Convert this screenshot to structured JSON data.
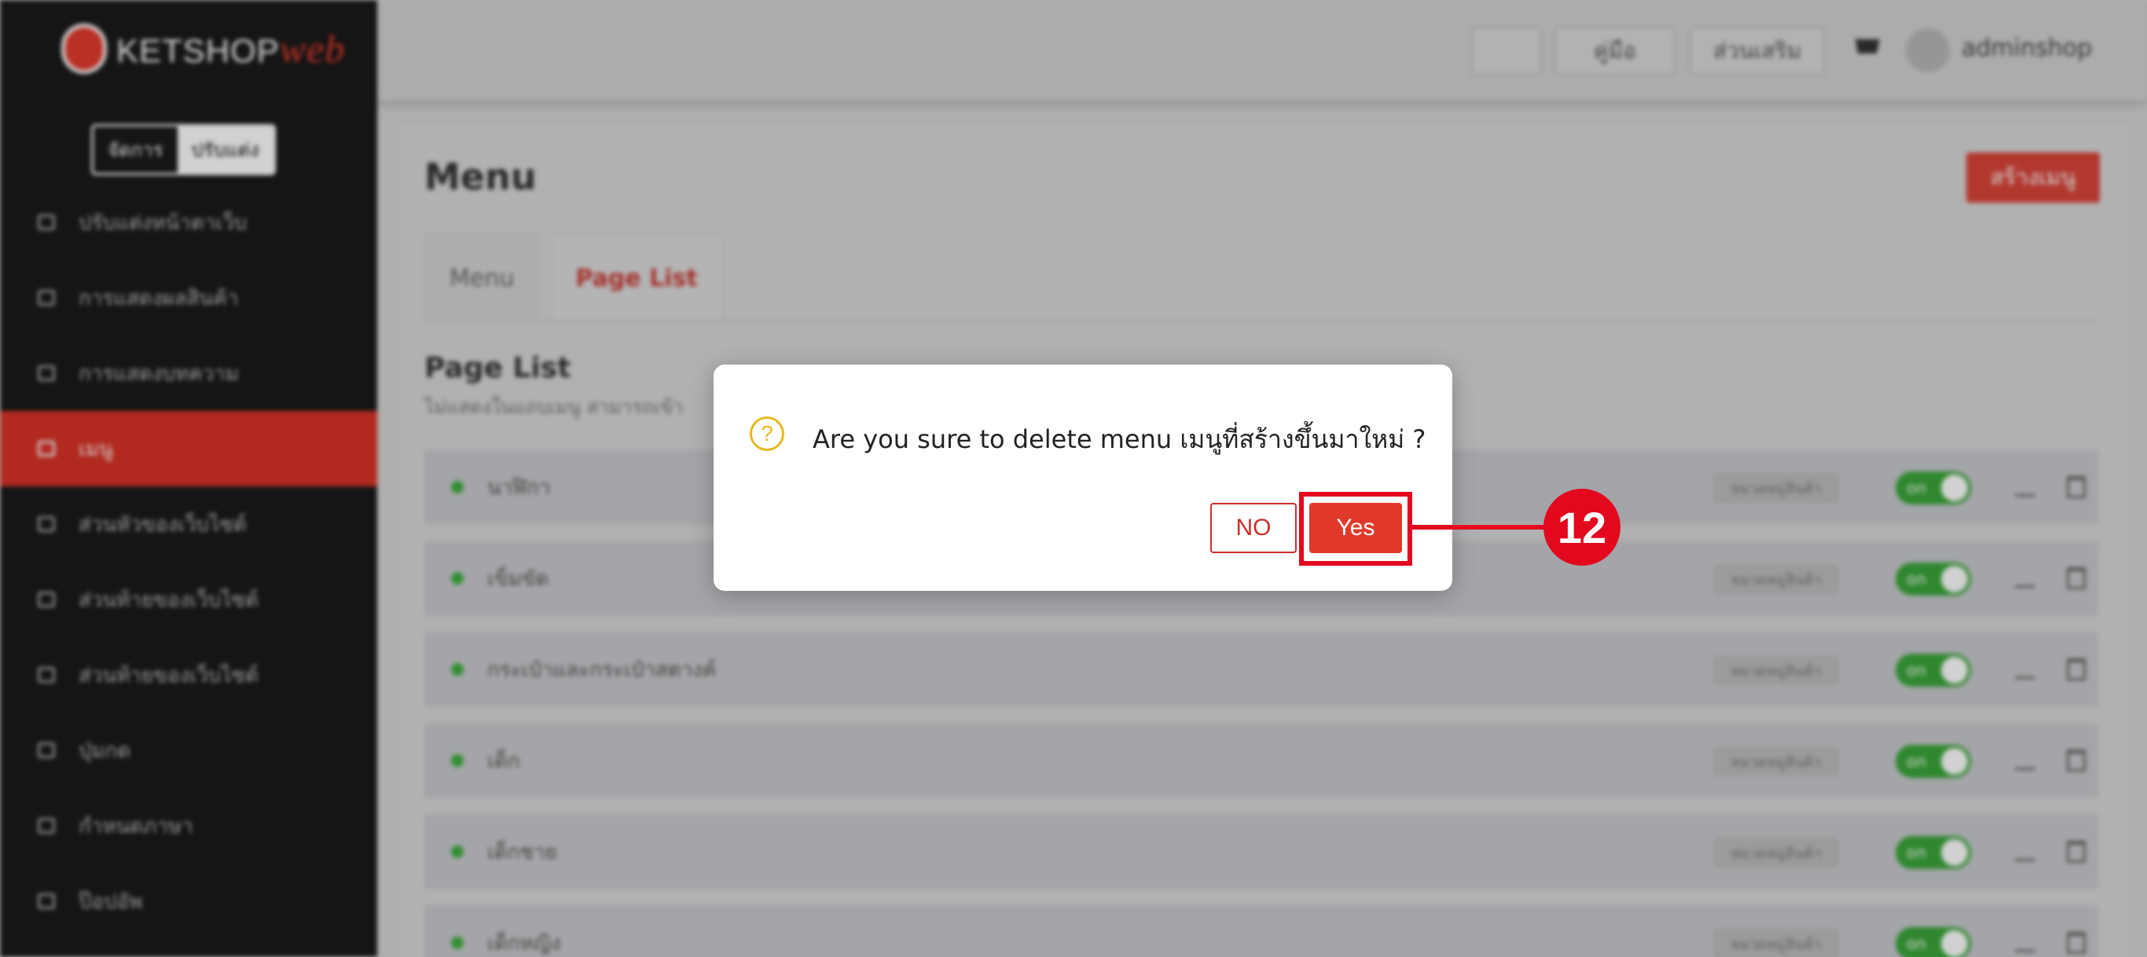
{
  "brand": {
    "logo_text": "KETSHOP",
    "logo_accent": "web"
  },
  "sidebar": {
    "mode_switch": [
      "จัดการ",
      "ปรับแต่ง"
    ],
    "items": [
      {
        "label": "ปรับแต่งหน้าตาเว็บ",
        "active": false
      },
      {
        "label": "การแสดงผลสินค้า",
        "active": false
      },
      {
        "label": "การแสดงบทความ",
        "active": false
      },
      {
        "label": "เมนู",
        "active": true
      },
      {
        "label": "ส่วนหัวของเว็บไซต์",
        "active": false
      },
      {
        "label": "ส่วนท้ายของเว็บไซต์",
        "active": false
      },
      {
        "label": "ส่วนท้ายของเว็บไซต์",
        "active": false
      },
      {
        "label": "ปุ่มกด",
        "active": false
      },
      {
        "label": "กำหนดภาษา",
        "active": false
      },
      {
        "label": "ป๊อปอัพ",
        "active": false
      }
    ]
  },
  "topbar": {
    "btn1": "",
    "btn2": "คู่มือ",
    "btn3": "ส่วนเสริม",
    "user": "adminshop"
  },
  "main": {
    "title": "Menu",
    "create_button": "สร้างเมนู",
    "tabs": [
      "Menu",
      "Page List"
    ],
    "section_title": "Page List",
    "section_desc": "ไม่แสดงในแถบเมนู สามารถเข้า",
    "rows": [
      {
        "name": "นาฬิกา",
        "tag": "หมวดหมู่สินค้า",
        "toggle": "on"
      },
      {
        "name": "เข็มขัด",
        "tag": "หมวดหมู่สินค้า",
        "toggle": "on"
      },
      {
        "name": "กระเป๋าและกระเป๋าสตางค์",
        "tag": "หมวดหมู่สินค้า",
        "toggle": "on"
      },
      {
        "name": "เด็ก",
        "tag": "หมวดหมู่สินค้า",
        "toggle": "on"
      },
      {
        "name": "เด็กชาย",
        "tag": "หมวดหมู่สินค้า",
        "toggle": "on"
      },
      {
        "name": "เด็กหญิง",
        "tag": "หมวดหมู่สินค้า",
        "toggle": "on"
      }
    ]
  },
  "dialog": {
    "icon": "?",
    "question": "Are you sure to delete menu เมนูที่สร้างขึ้นมาใหม่ ?",
    "no_label": "NO",
    "yes_label": "Yes"
  },
  "annotation": {
    "step": "12"
  },
  "colors": {
    "accent": "#e0392b",
    "annotation": "#e3081e",
    "warning": "#e8b81e",
    "toggle_on": "#3aa63a"
  }
}
